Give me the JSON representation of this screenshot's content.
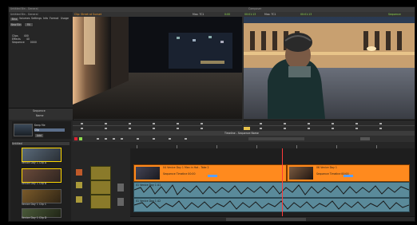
{
  "app": {
    "project_window_title": "Untitled Bin - General",
    "composer_title": "Composer",
    "timeline_title": "Timeline - Sequence Name",
    "sequence_name": "Sequence"
  },
  "bin_panel": {
    "tabs": [
      "Bins",
      "Volumes",
      "Settings",
      "Info",
      "Format",
      "Usage"
    ],
    "buttons": [
      "New Bin",
      "Fill"
    ],
    "properties": [
      {
        "label": "Clips",
        "value": "400"
      },
      {
        "label": "Effects",
        "value": "40"
      },
      {
        "label": "Sequence",
        "value": "0000"
      }
    ],
    "bottom_header": "Sequence",
    "bottom_header2": "Name",
    "selected_label": "Keep Me",
    "footer_label": "Untitled",
    "mini_label": "Clip",
    "mini_button": "Add",
    "clips": [
      {
        "label": "Venice Day 1 Clip A"
      },
      {
        "label": "Venice Day 1 Clip B"
      },
      {
        "label": "Venice Day 1 Clip C"
      },
      {
        "label": "Venice Day 1 Clip D"
      }
    ]
  },
  "source_monitor": {
    "header_label": "Clip: Street at Sunset",
    "readout_left": "Mas: TC1",
    "readout_value": "0:00",
    "timecode": "00:01:13"
  },
  "record_monitor": {
    "readout_left": "Mas: TC1",
    "timecode": "00:01:13",
    "sequence_label": "Sequence"
  },
  "timeline": {
    "header": "Timeline - Sequence Name",
    "clip_title_1": "04 Venice Day 1 Man in Hat - Take 2",
    "clip_sub_1": "Sequence Timeline 00:00",
    "clip_title_2": "06 Venice Day 1",
    "clip_sub_2": "Sequence Timeline 00:00",
    "audio_label_1": "01 Venice Day 1 A1",
    "audio_label_2": "01 Venice Day 1 A2"
  },
  "colors": {
    "orange": "#ff8a1e",
    "audio": "#5a8a9a",
    "panel": "#2c2c2c",
    "highlight": "#8edb4e"
  }
}
